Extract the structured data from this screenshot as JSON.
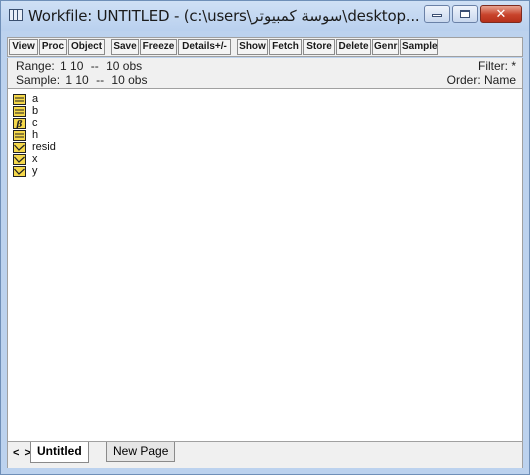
{
  "window": {
    "title": "Workfile: UNTITLED - (c:\\users\\سوسة كمبيوتر\\desktop..."
  },
  "toolbar": {
    "buttons": [
      "View",
      "Proc",
      "Object",
      "Save",
      "Freeze",
      "Details+/-",
      "Show",
      "Fetch",
      "Store",
      "Delete",
      "Genr",
      "Sample"
    ]
  },
  "info": {
    "range_label": "Range:",
    "range_value": "1 10",
    "range_sep": "--",
    "range_obs": "10 obs",
    "sample_label": "Sample:",
    "sample_value": "1 10",
    "sample_sep": "--",
    "sample_obs": "10 obs",
    "filter": "Filter: *",
    "order": "Order: Name"
  },
  "objects": [
    {
      "name": "a",
      "icon": "coef-icon"
    },
    {
      "name": "b",
      "icon": "coef-icon"
    },
    {
      "name": "c",
      "icon": "beta-icon"
    },
    {
      "name": "h",
      "icon": "coef-icon"
    },
    {
      "name": "resid",
      "icon": "series-icon"
    },
    {
      "name": "x",
      "icon": "series-icon"
    },
    {
      "name": "y",
      "icon": "series-icon"
    }
  ],
  "tabs": {
    "nav": "< >",
    "items": [
      "Untitled",
      "New Page"
    ],
    "active": "Untitled"
  },
  "colors": {
    "frame": "#bcd2ee",
    "close": "#c8432b",
    "icon_fill": "#f5d84a"
  }
}
